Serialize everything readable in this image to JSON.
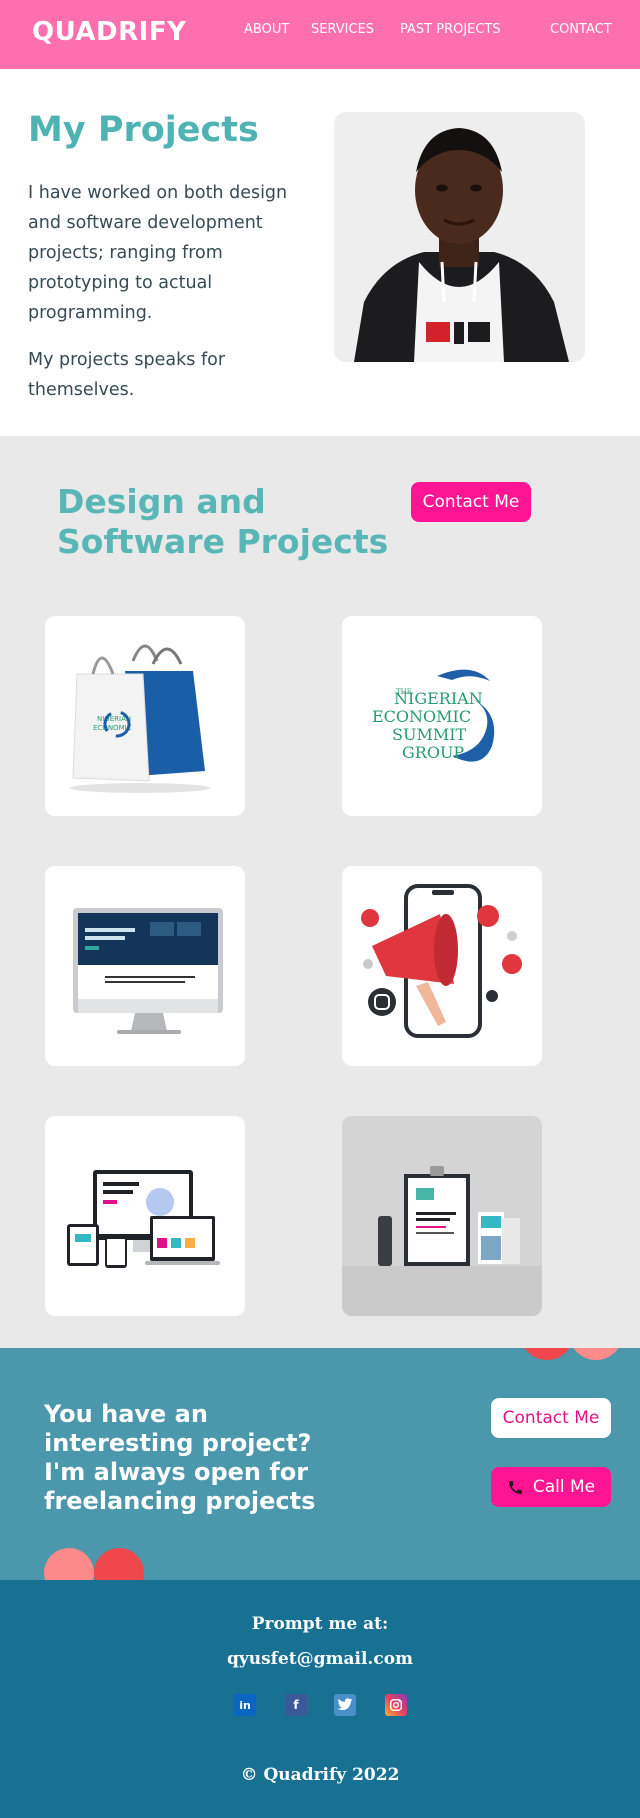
{
  "header": {
    "logo": "QUADRIFY",
    "nav": [
      "ABOUT",
      "SERVICES",
      "PAST PROJECTS",
      "CONTACT"
    ]
  },
  "hero": {
    "title": "My Projects",
    "paragraph1": "I have worked on both design and software development projects; ranging from prototyping to actual programming.",
    "paragraph2": "My projects speaks for themselves."
  },
  "projects": {
    "title": "Design and Software Projects",
    "contact_button": "Contact Me",
    "nesg_logo": {
      "line0": "THE",
      "line1": "NIGERIAN",
      "line2": "ECONOMIC",
      "line3": "SUMMIT",
      "line4": "GROUP"
    }
  },
  "cta": {
    "text": "You have an interesting project? I'm always open for freelancing projects",
    "contact_button": "Contact Me",
    "call_button": "Call Me"
  },
  "footer": {
    "prompt": "Prompt me at:",
    "email": "qyusfet@gmail.com",
    "copyright": "© Quadrify 2022",
    "social": [
      "in",
      "f",
      "tw",
      "ig"
    ]
  },
  "colors": {
    "header": "#fe6fb0",
    "accent_teal": "#4fb3b3",
    "button_pink": "#ff1493",
    "cta_bg": "#4b97ab",
    "footer_bg": "#187192"
  }
}
